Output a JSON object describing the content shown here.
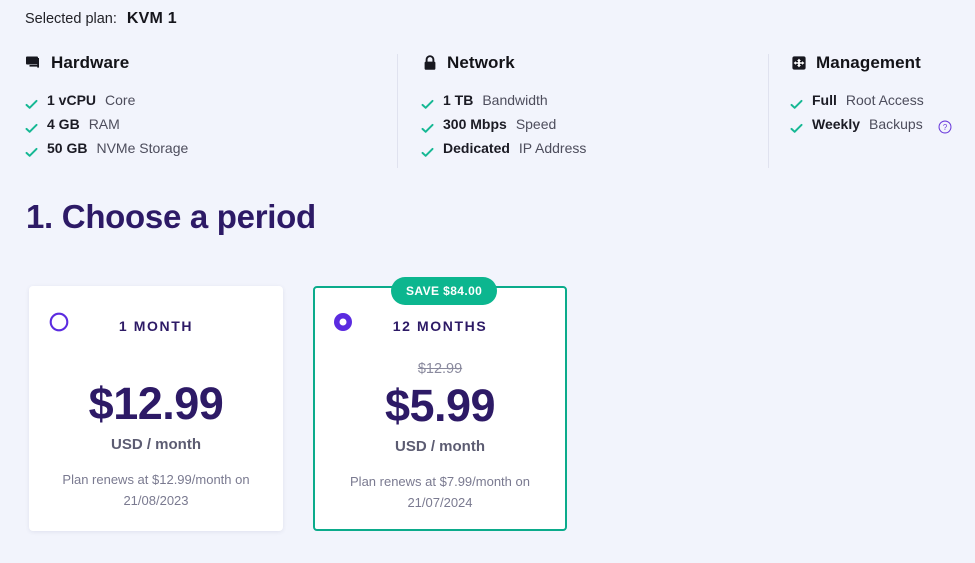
{
  "header": {
    "selected_plan_label": "Selected plan:",
    "selected_plan_value": "KVM 1"
  },
  "feature_columns": [
    {
      "icon": "server-icon",
      "title": "Hardware",
      "items": [
        {
          "strong": "1 vCPU",
          "rest": "Core"
        },
        {
          "strong": "4 GB",
          "rest": "RAM"
        },
        {
          "strong": "50 GB",
          "rest": "NVMe Storage"
        }
      ]
    },
    {
      "icon": "lock-icon",
      "title": "Network",
      "items": [
        {
          "strong": "1 TB",
          "rest": "Bandwidth"
        },
        {
          "strong": "300 Mbps",
          "rest": "Speed"
        },
        {
          "strong": "Dedicated",
          "rest": "IP Address"
        }
      ]
    },
    {
      "icon": "management-icon",
      "title": "Management",
      "items": [
        {
          "strong": "Full",
          "rest": "Root Access"
        },
        {
          "strong": "Weekly",
          "rest": "Backups",
          "help": "help-icon"
        }
      ]
    }
  ],
  "step": {
    "heading": "1. Choose a period"
  },
  "periods": [
    {
      "term": "1 MONTH",
      "selected": false,
      "old_price": "",
      "price": "$12.99",
      "unit": "USD / month",
      "renew_line1": "Plan renews at $12.99/month on",
      "renew_line2": "21/08/2023",
      "badge": ""
    },
    {
      "term": "12 MONTHS",
      "selected": true,
      "old_price": "$12.99",
      "price": "$5.99",
      "unit": "USD / month",
      "renew_line1": "Plan renews at $7.99/month on",
      "renew_line2": "21/07/2024",
      "badge": "SAVE $84.00"
    }
  ],
  "colors": {
    "page_background": "#f2f4fc",
    "accent_purple": "#5b2be0",
    "heading_purple": "#2d1a66",
    "accent_green": "#0bab8b",
    "badge_green": "#0cb68f",
    "check_green": "#16b894"
  }
}
